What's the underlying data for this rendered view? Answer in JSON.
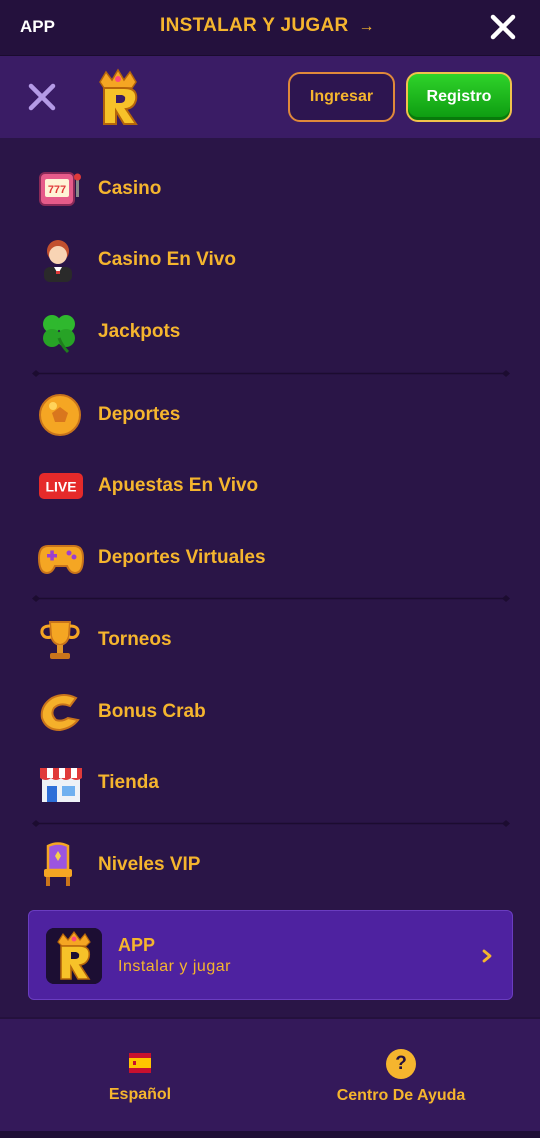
{
  "banner": {
    "app_label": "APP",
    "install_label": "INSTALAR Y JUGAR",
    "arrow": "→"
  },
  "header": {
    "login_label": "Ingresar",
    "register_label": "Registro"
  },
  "menu": {
    "items": [
      {
        "label": "Casino",
        "icon": "slot-machine-icon"
      },
      {
        "label": "Casino En Vivo",
        "icon": "live-dealer-icon"
      },
      {
        "label": "Jackpots",
        "icon": "clover-icon"
      },
      {
        "label": "Deportes",
        "icon": "soccer-ball-icon"
      },
      {
        "label": "Apuestas En Vivo",
        "icon": "live-badge-icon",
        "badge": "LIVE"
      },
      {
        "label": "Deportes Virtuales",
        "icon": "gamepad-icon"
      },
      {
        "label": "Torneos",
        "icon": "trophy-icon"
      },
      {
        "label": "Bonus Crab",
        "icon": "crab-claw-icon"
      },
      {
        "label": "Tienda",
        "icon": "shop-icon"
      },
      {
        "label": "Niveles VIP",
        "icon": "vip-throne-icon"
      }
    ]
  },
  "app_card": {
    "title": "APP",
    "subtitle": "Instalar y jugar"
  },
  "footer": {
    "language_label": "Español",
    "help_label": "Centro De Ayuda",
    "help_glyph": "?"
  },
  "colors": {
    "accent": "#f5b52e",
    "background": "#2a1547",
    "header": "#3a1c65",
    "register": "#12b515"
  }
}
